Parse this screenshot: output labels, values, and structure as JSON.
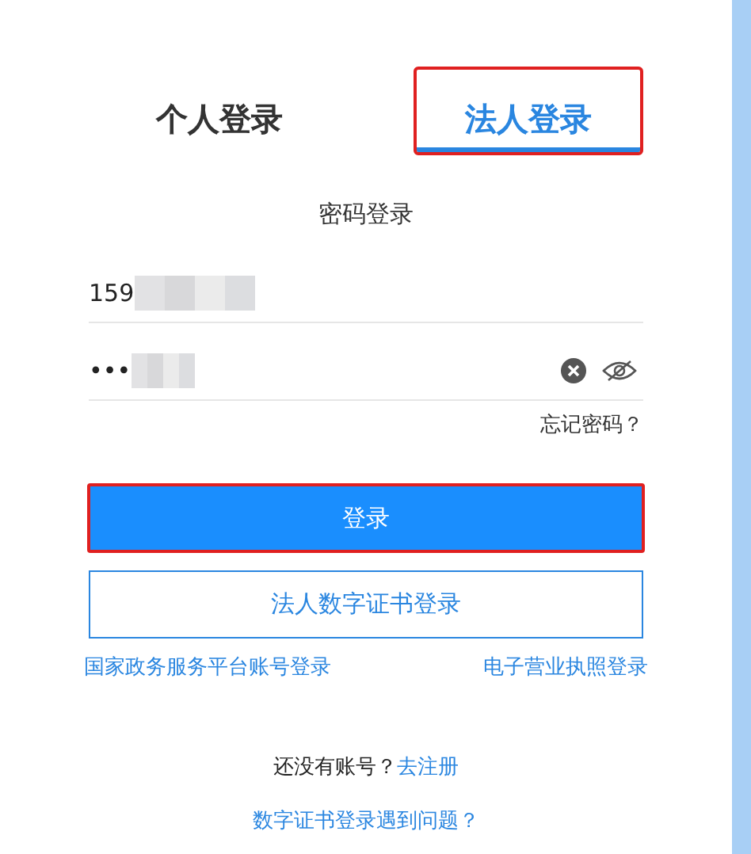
{
  "tabs": [
    {
      "label": "个人登录",
      "selected": false,
      "highlighted": false
    },
    {
      "label": "法人登录",
      "selected": true,
      "highlighted": true
    }
  ],
  "subtitle": "密码登录",
  "username": {
    "value": "159",
    "redacted": true
  },
  "password": {
    "value": "•••",
    "redacted": true
  },
  "forgot_link": "忘记密码？",
  "login_button": {
    "label": "登录",
    "highlighted": true
  },
  "cert_button": "法人数字证书登录",
  "alt_links": [
    "国家政务服务平台账号登录",
    "电子营业执照登录"
  ],
  "register": {
    "prompt": "还没有账号？",
    "link": "去注册"
  },
  "help_link": "数字证书登录遇到问题？"
}
